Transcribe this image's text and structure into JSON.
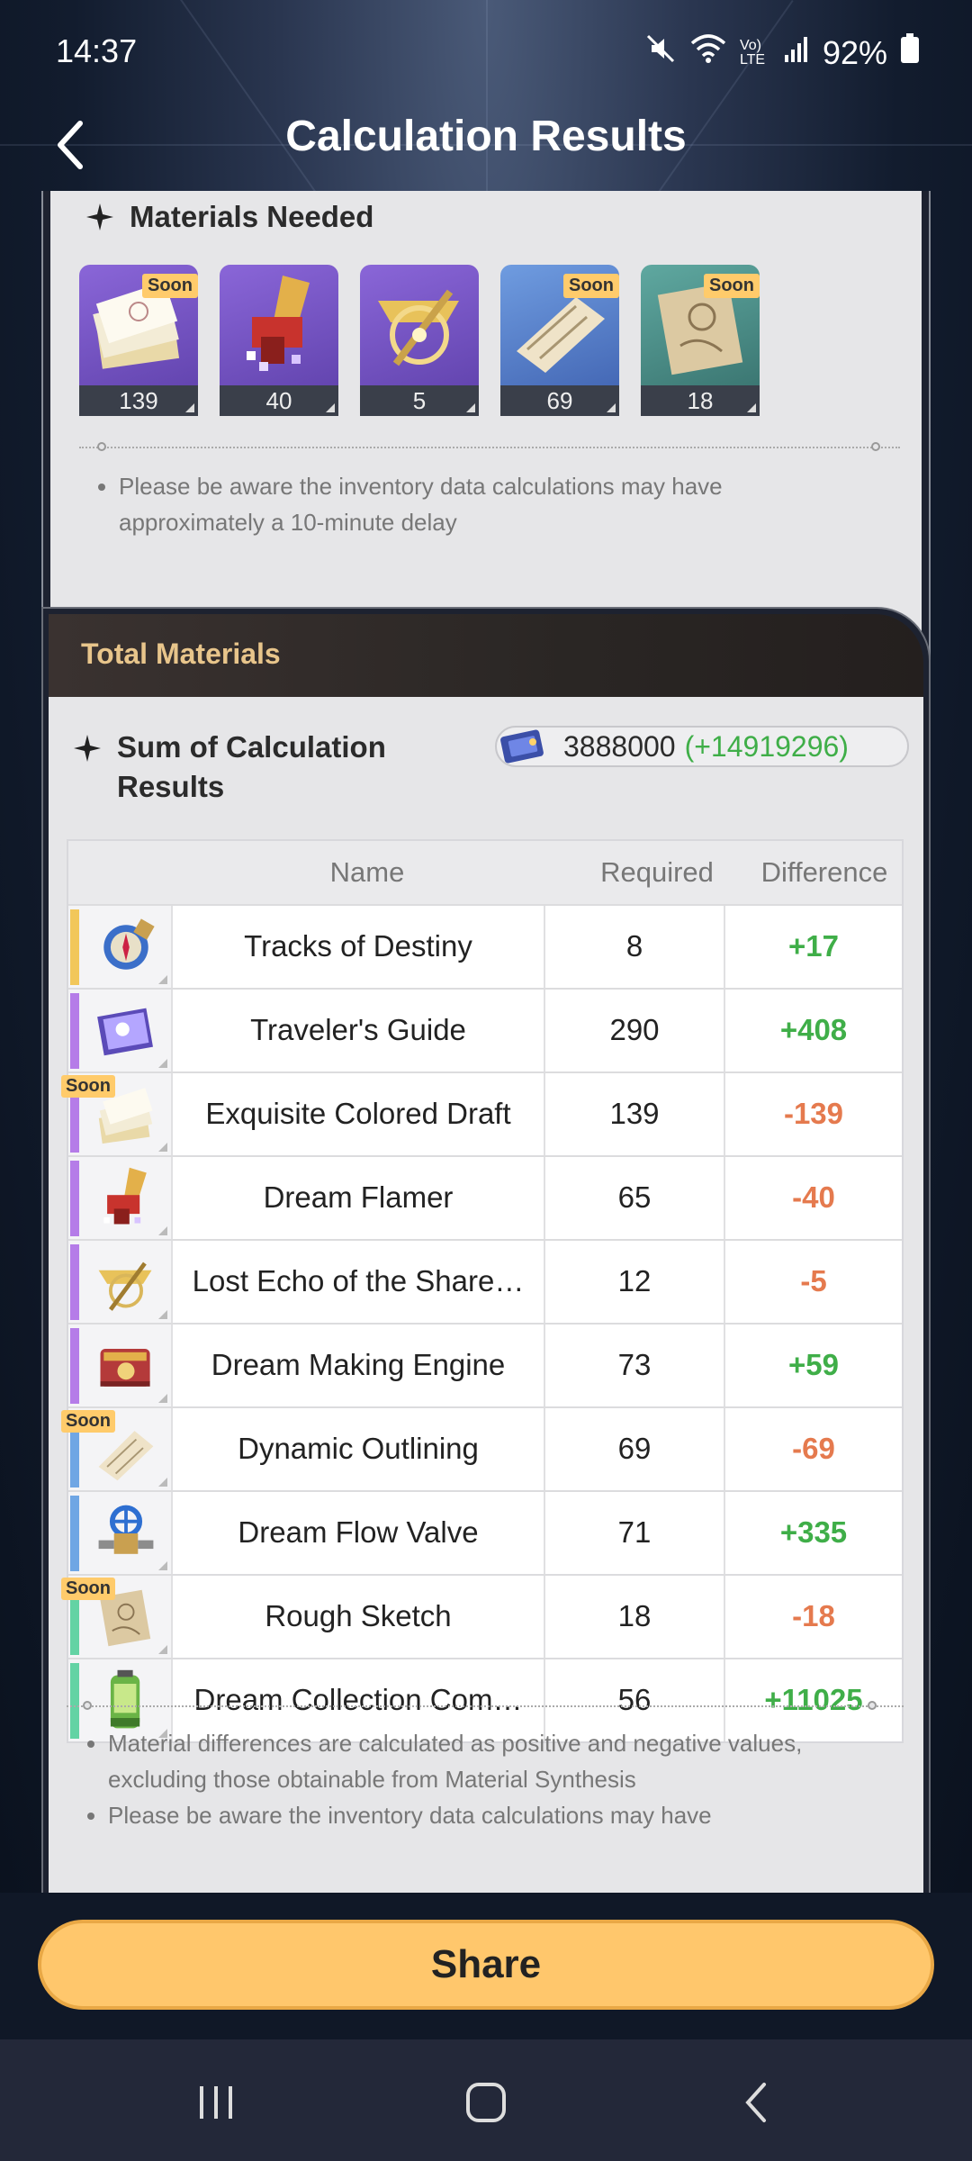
{
  "status_bar": {
    "time": "14:37",
    "battery": "92%",
    "network_label": "Vo) LTE"
  },
  "header": {
    "title": "Calculation Results",
    "back_icon": "chevron-left-icon"
  },
  "materials_needed": {
    "title": "Materials Needed",
    "items": [
      {
        "count": "139",
        "soon": "Soon",
        "rarity": "purple",
        "icon": "draft-papers-icon"
      },
      {
        "count": "40",
        "soon": "",
        "rarity": "purple",
        "icon": "flamer-icon"
      },
      {
        "count": "5",
        "soon": "",
        "rarity": "purple",
        "icon": "echo-emblem-icon"
      },
      {
        "count": "69",
        "soon": "Soon",
        "rarity": "blue",
        "icon": "outline-scroll-icon"
      },
      {
        "count": "18",
        "soon": "Soon",
        "rarity": "teal",
        "icon": "sketch-paper-icon"
      }
    ],
    "note": "Please be aware the inventory data calculations may have approximately a 10-minute delay"
  },
  "total_materials": {
    "title": "Total Materials",
    "sum_label": "Sum of Calculation Results",
    "sum_value": "3888000",
    "sum_diff": "(+14919296)",
    "columns": {
      "name": "Name",
      "required": "Required",
      "difference": "Difference"
    },
    "rows": [
      {
        "name": "Tracks of Destiny",
        "required": "8",
        "difference": "+17",
        "sign": "pos",
        "soon": "",
        "rarity": "#f2c75a",
        "icon": "compass-orb-icon"
      },
      {
        "name": "Traveler's Guide",
        "required": "290",
        "difference": "+408",
        "sign": "pos",
        "soon": "",
        "rarity": "#b57ce8",
        "icon": "guide-book-icon"
      },
      {
        "name": "Exquisite Colored Draft",
        "required": "139",
        "difference": "-139",
        "sign": "neg",
        "soon": "Soon",
        "rarity": "#b57ce8",
        "icon": "draft-papers-icon"
      },
      {
        "name": "Dream Flamer",
        "required": "65",
        "difference": "-40",
        "sign": "neg",
        "soon": "",
        "rarity": "#b57ce8",
        "icon": "flamer-icon"
      },
      {
        "name": "Lost Echo of the Share…",
        "required": "12",
        "difference": "-5",
        "sign": "neg",
        "soon": "",
        "rarity": "#b57ce8",
        "icon": "echo-emblem-icon"
      },
      {
        "name": "Dream Making Engine",
        "required": "73",
        "difference": "+59",
        "sign": "pos",
        "soon": "",
        "rarity": "#b57ce8",
        "icon": "engine-chest-icon"
      },
      {
        "name": "Dynamic Outlining",
        "required": "69",
        "difference": "-69",
        "sign": "neg",
        "soon": "Soon",
        "rarity": "#6fa6e4",
        "icon": "outline-scroll-icon"
      },
      {
        "name": "Dream Flow Valve",
        "required": "71",
        "difference": "+335",
        "sign": "pos",
        "soon": "",
        "rarity": "#6fa6e4",
        "icon": "valve-icon"
      },
      {
        "name": "Rough Sketch",
        "required": "18",
        "difference": "-18",
        "sign": "neg",
        "soon": "Soon",
        "rarity": "#63d3a4",
        "icon": "sketch-paper-icon"
      },
      {
        "name": "Dream Collection Com…",
        "required": "56",
        "difference": "+11025",
        "sign": "pos",
        "soon": "",
        "rarity": "#63d3a4",
        "icon": "collection-canister-icon"
      }
    ],
    "notes": [
      "Material differences are calculated as positive and negative values, excluding those obtainable from Material Synthesis",
      "Please be aware the inventory data calculations may have"
    ]
  },
  "share_button": "Share",
  "nav": {
    "recents_icon": "recents-icon",
    "home_icon": "home-icon",
    "back_icon": "back-icon"
  }
}
